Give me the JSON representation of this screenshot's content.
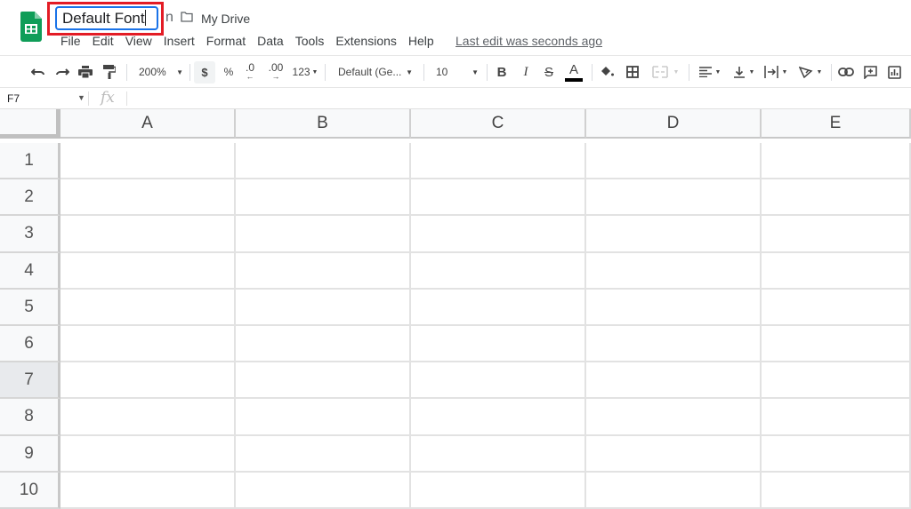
{
  "app": {
    "name": "Google Sheets",
    "brand_color": "#0f9d58"
  },
  "document": {
    "title": "Default Font",
    "title_suffix": "n",
    "folder_icon": "folder-icon",
    "location": "My Drive",
    "last_edit": "Last edit was seconds ago"
  },
  "menu": [
    "File",
    "Edit",
    "View",
    "Insert",
    "Format",
    "Data",
    "Tools",
    "Extensions",
    "Help"
  ],
  "toolbar": {
    "zoom": "200%",
    "currency": "$",
    "percent": "%",
    "decrease_decimal": ".0",
    "increase_decimal": ".00",
    "more_formats": "123",
    "font": "Default (Ge...",
    "font_size": "10",
    "bold": "B",
    "italic": "I",
    "strikethrough": "S",
    "text_color_label": "A",
    "text_color": "#000000"
  },
  "formula_bar": {
    "cell_ref": "F7",
    "fx": "fx",
    "value": ""
  },
  "grid": {
    "columns": [
      "A",
      "B",
      "C",
      "D",
      "E"
    ],
    "rows": [
      "1",
      "2",
      "3",
      "4",
      "5",
      "6",
      "7",
      "8",
      "9",
      "10"
    ],
    "selected_row": "7",
    "selected_cell": "F7"
  },
  "annotation": {
    "highlight_color": "#e31c25",
    "target": "document-title"
  }
}
